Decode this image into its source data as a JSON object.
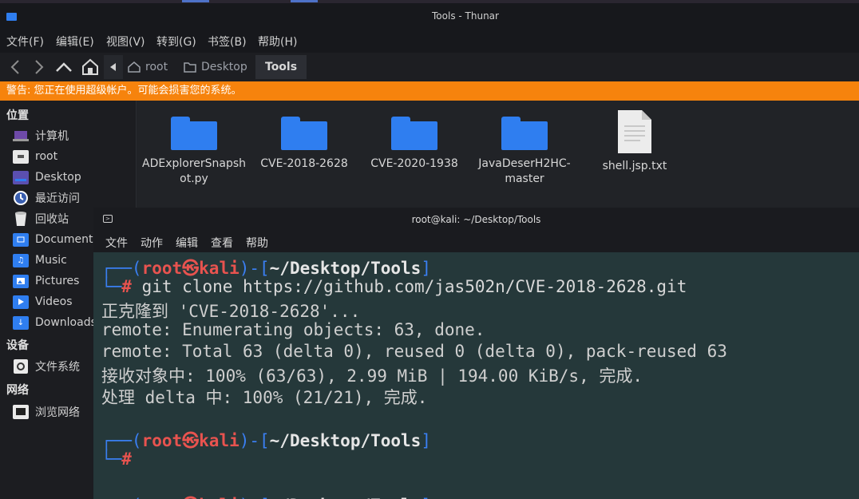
{
  "window": {
    "title": "Tools - Thunar"
  },
  "menu": [
    "文件(F)",
    "编辑(E)",
    "视图(V)",
    "转到(G)",
    "书签(B)",
    "帮助(H)"
  ],
  "path": {
    "items": [
      "root",
      "Desktop"
    ],
    "current": "Tools"
  },
  "warning": "警告: 您正在使用超级帐户。可能会损害您的系统。",
  "sidebar": {
    "places_header": "位置",
    "places": [
      "计算机",
      "root",
      "Desktop",
      "最近访问",
      "回收站",
      "Documents",
      "Music",
      "Pictures",
      "Videos",
      "Downloads"
    ],
    "devices_header": "设备",
    "devices": [
      "文件系统"
    ],
    "network_header": "网络",
    "network": [
      "浏览网络"
    ]
  },
  "files": [
    {
      "name_lines": [
        "ADExplorerSnapsh",
        "ot.py"
      ],
      "icon": "folder-icon"
    },
    {
      "name_lines": [
        "CVE-2018-2628"
      ],
      "icon": "folder-icon"
    },
    {
      "name_lines": [
        "CVE-2020-1938"
      ],
      "icon": "folder-icon"
    },
    {
      "name_lines": [
        "JavaDeserH2HC-",
        "master"
      ],
      "icon": "folder-icon"
    },
    {
      "name_lines": [
        "shell.jsp.txt"
      ],
      "icon": "text-file-icon"
    }
  ],
  "terminal": {
    "title": "root@kali: ~/Desktop/Tools",
    "menu": [
      "文件",
      "动作",
      "编辑",
      "查看",
      "帮助"
    ],
    "prompt": {
      "user": "root",
      "host": "kali",
      "path": "~/Desktop/Tools"
    },
    "command": "git clone https://github.com/jas502n/CVE-2018-2628.git",
    "output": [
      "正克隆到 'CVE-2018-2628'...",
      "remote: Enumerating objects: 63, done.",
      "remote: Total 63 (delta 0), reused 0 (delta 0), pack-reused 63",
      "接收对象中: 100% (63/63), 2.99 MiB | 194.00 KiB/s, 完成.",
      "处理 delta 中: 100% (21/21), 完成."
    ]
  }
}
